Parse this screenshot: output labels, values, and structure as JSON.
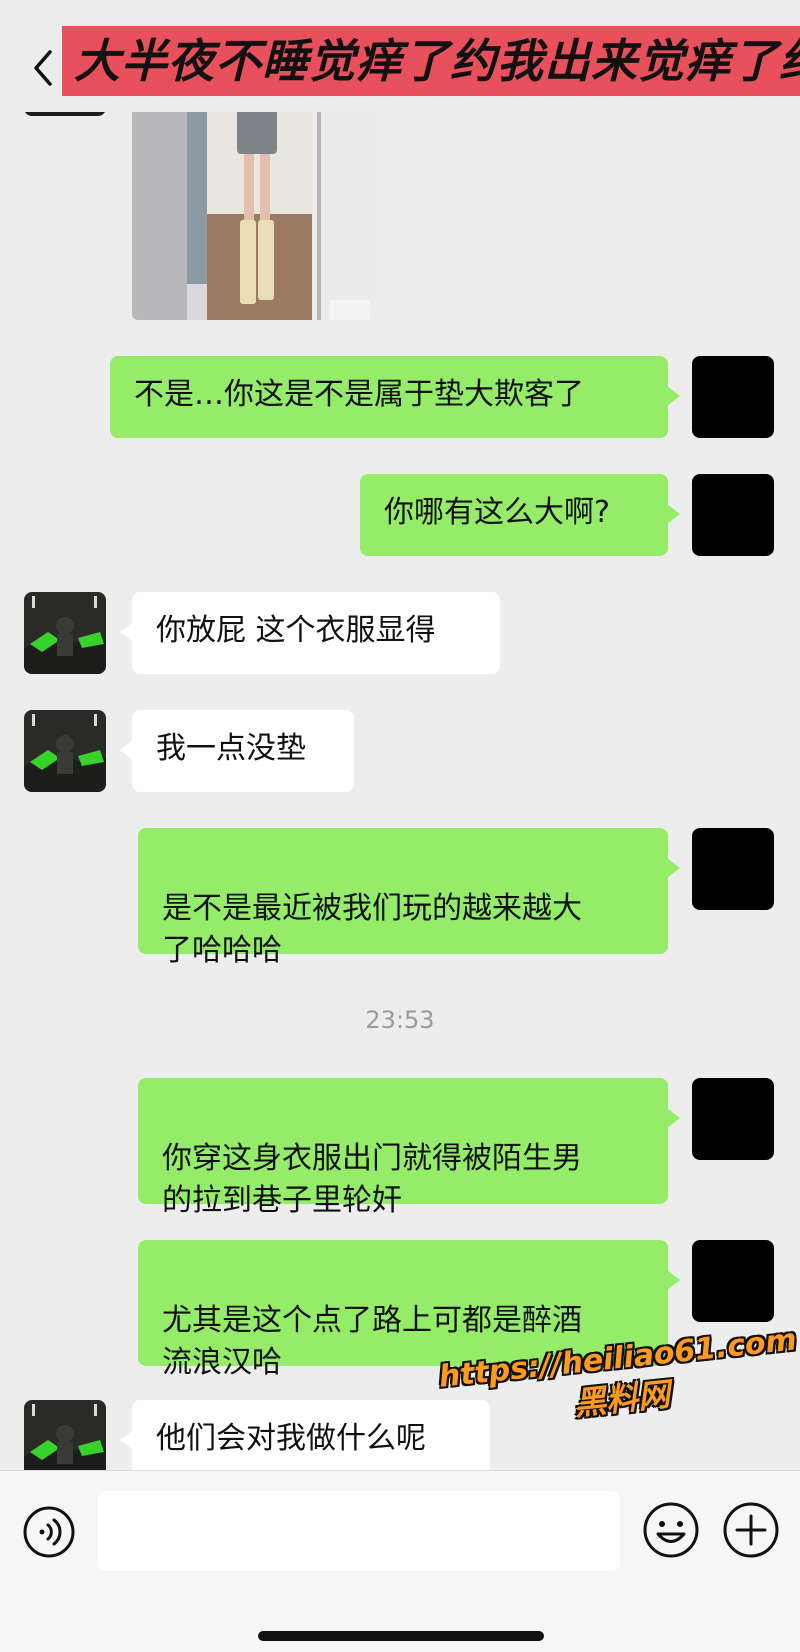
{
  "header": {
    "title": "大半夜不睡觉痒了约我出来觉痒了约"
  },
  "messages": [
    {
      "side": "right",
      "text": "不是…你这是不是属于垫大欺客了"
    },
    {
      "side": "right",
      "text": "你哪有这么大啊?"
    },
    {
      "side": "left",
      "text": "你放屁 这个衣服显得"
    },
    {
      "side": "left",
      "text": "我一点没垫"
    },
    {
      "side": "right",
      "text": "是不是最近被我们玩的越来越大\n了哈哈哈"
    },
    {
      "side": "right",
      "text": "你穿这身衣服出门就得被陌生男\n的拉到巷子里轮奸"
    },
    {
      "side": "right",
      "text": "尤其是这个点了路上可都是醉酒\n流浪汉哈"
    },
    {
      "side": "left",
      "text": "他们会对我做什么呢"
    }
  ],
  "timestamp": "23:53",
  "watermark": {
    "url": "https://heiliao61.com",
    "name": "黑料网"
  },
  "icons": {
    "back": "chevron-left-icon",
    "voice": "voice-icon",
    "emoji": "emoji-icon",
    "plus": "plus-icon"
  },
  "colors": {
    "self_bubble": "#95ec69",
    "other_bubble": "#ffffff",
    "background": "#ededed",
    "title_banner": "#e8505b",
    "watermark": "#ff9a1e"
  }
}
